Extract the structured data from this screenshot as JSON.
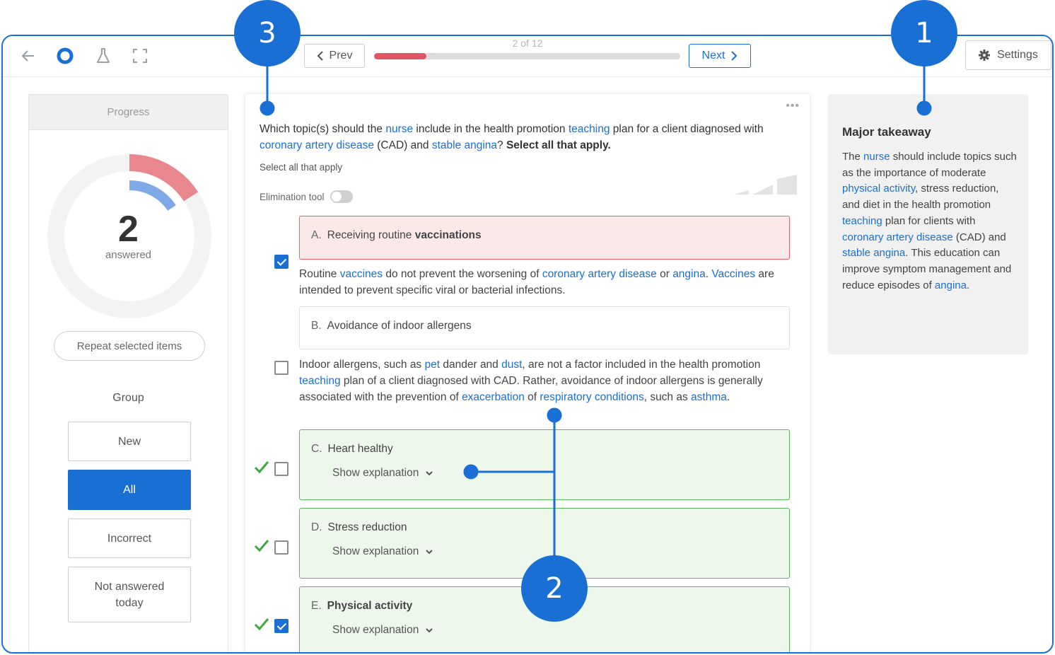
{
  "toolbar": {
    "prev_label": "Prev",
    "next_label": "Next",
    "progress_text": "2 of 12",
    "progress_fraction": 0.17,
    "settings_label": "Settings",
    "icons": [
      "back-arrow-icon",
      "app-logo-icon",
      "flask-icon",
      "fullscreen-icon",
      "gear-icon"
    ],
    "progress_color": "#e05561"
  },
  "left": {
    "header": "Progress",
    "answered_count": "2",
    "answered_label": "answered",
    "repeat_label": "Repeat selected items",
    "group_label": "Group",
    "groups": [
      {
        "label": "New",
        "active": false
      },
      {
        "label": "All",
        "active": true
      },
      {
        "label": "Incorrect",
        "active": false
      },
      {
        "label": "Not answered today",
        "active": false
      }
    ]
  },
  "question": {
    "stem_1": "Which topic(s) should the ",
    "stem_link_nurse": "nurse",
    "stem_2": " include in the health promotion ",
    "stem_link_teaching": "teaching",
    "stem_3": " plan for a client diagnosed with ",
    "stem_link_cad": "coronary artery disease",
    "stem_4": " (CAD) and ",
    "stem_link_angina": "stable angina",
    "stem_5": "? ",
    "stem_bold": "Select all that apply.",
    "hint": "Select all that apply",
    "elimination_label": "Elimination tool",
    "options": [
      {
        "letter": "A.",
        "text": "Receiving routine ",
        "bold": "vaccinations",
        "status": "incorrect",
        "checked": true
      },
      {
        "letter": "B.",
        "text": "Avoidance of indoor allergens",
        "status": "neutral",
        "checked": false
      },
      {
        "letter": "C.",
        "text": "Heart healthy",
        "status": "correct",
        "checked": false,
        "show_explanation": "Show explanation"
      },
      {
        "letter": "D.",
        "text": "Stress reduction",
        "status": "correct",
        "checked": false,
        "show_explanation": "Show explanation"
      },
      {
        "letter": "E.",
        "text": "Physical activity",
        "status": "correct",
        "checked": true,
        "show_explanation": "Show explanation"
      }
    ],
    "explain_a": {
      "t1": "Routine ",
      "l1": "vaccines",
      "t2": " do not prevent the worsening of ",
      "l2": "coronary artery disease",
      "t3": " or ",
      "l3": "angina",
      "t4": ". ",
      "l4": "Vaccines",
      "t5": " are intended to prevent specific viral or bacterial infections."
    },
    "explain_b": {
      "t1": "Indoor allergens, such as ",
      "l1": "pet",
      "t2": " dander and ",
      "l2": "dust",
      "t3": ", are not a factor included in the health promotion ",
      "l3": "teaching",
      "t4": " plan of a client diagnosed with CAD. Rather, avoidance of indoor allergens is generally associated with the prevention of ",
      "l4": "exacerbation",
      "t5": " of ",
      "l5": "respiratory conditions",
      "t6": ", such as ",
      "l6": "asthma",
      "t7": "."
    }
  },
  "takeaway": {
    "title": "Major takeaway",
    "t1": "The ",
    "l1": "nurse",
    "t2": " should include topics such as the importance of moderate ",
    "l2": "physical activity",
    "t3": ", stress reduction, and diet in the health promotion ",
    "l3": "teaching",
    "t4": " plan for clients with ",
    "l4": "coronary artery disease",
    "t5": " (CAD) and ",
    "l5": "stable angina",
    "t6": ". This education can improve symptom management and reduce episodes of ",
    "l6": "angina",
    "t7": "."
  },
  "callouts": [
    "1",
    "2",
    "3"
  ],
  "colors": {
    "accent": "#1a6fd4",
    "incorrect": "#e8616b",
    "correct": "#5cb85c"
  }
}
